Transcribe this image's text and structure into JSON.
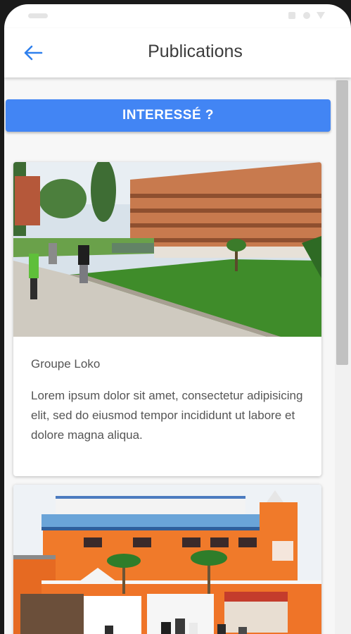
{
  "header": {
    "title": "Publications",
    "back_icon": "arrow-left-icon"
  },
  "cta": {
    "label": "INTERESSÉ ?"
  },
  "colors": {
    "accent": "#4285f4",
    "back_arrow": "#2f80ed"
  },
  "publications": [
    {
      "title": "Groupe Loko",
      "text": "Lorem ipsum dolor sit amet, consectetur adipisicing elit, sed do eiusmod tempor incididunt ut labore et dolore magna aliqua."
    }
  ]
}
